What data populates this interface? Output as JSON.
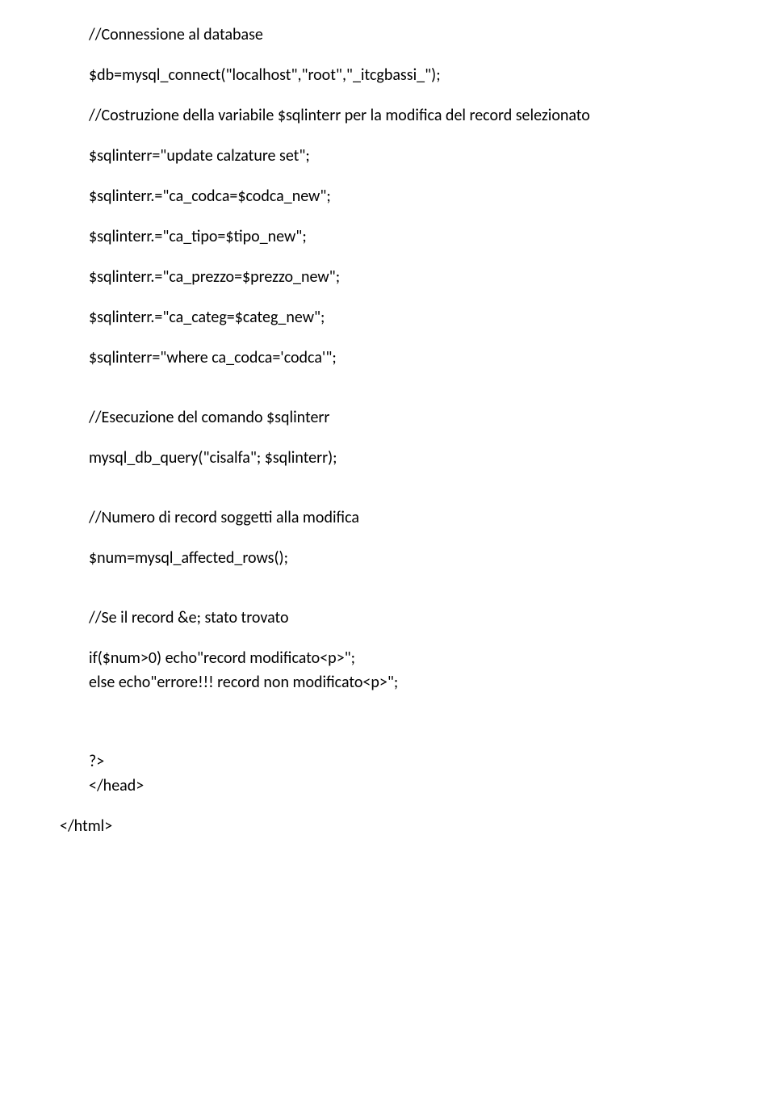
{
  "lines": {
    "l1": "//Connessione al database",
    "l2": "$db=mysql_connect(\"localhost\",\"root\",\"_itcgbassi_\");",
    "l3": "//Costruzione della variabile $sqlinterr per la modifica del record selezionato",
    "l4": "$sqlinterr=\"update calzature set\";",
    "l5": "$sqlinterr.=\"ca_codca=$codca_new\";",
    "l6": "$sqlinterr.=\"ca_tipo=$tipo_new\";",
    "l7": "$sqlinterr.=\"ca_prezzo=$prezzo_new\";",
    "l8": "$sqlinterr.=\"ca_categ=$categ_new\";",
    "l9": "$sqlinterr=\"where ca_codca='codca'\";",
    "l10": "//Esecuzione del comando $sqlinterr",
    "l11": "mysql_db_query(\"cisalfa\"; $sqlinterr);",
    "l12": "//Numero di record soggetti alla modifica",
    "l13": "$num=mysql_affected_rows();",
    "l14": "//Se il record &e; stato trovato",
    "l15": "if($num>0) echo\"record modificato<p>\";",
    "l16": "else echo\"errore!!! record non modificato<p>\";",
    "l17": "?>",
    "l18": "</head>",
    "l19": "</html>"
  }
}
